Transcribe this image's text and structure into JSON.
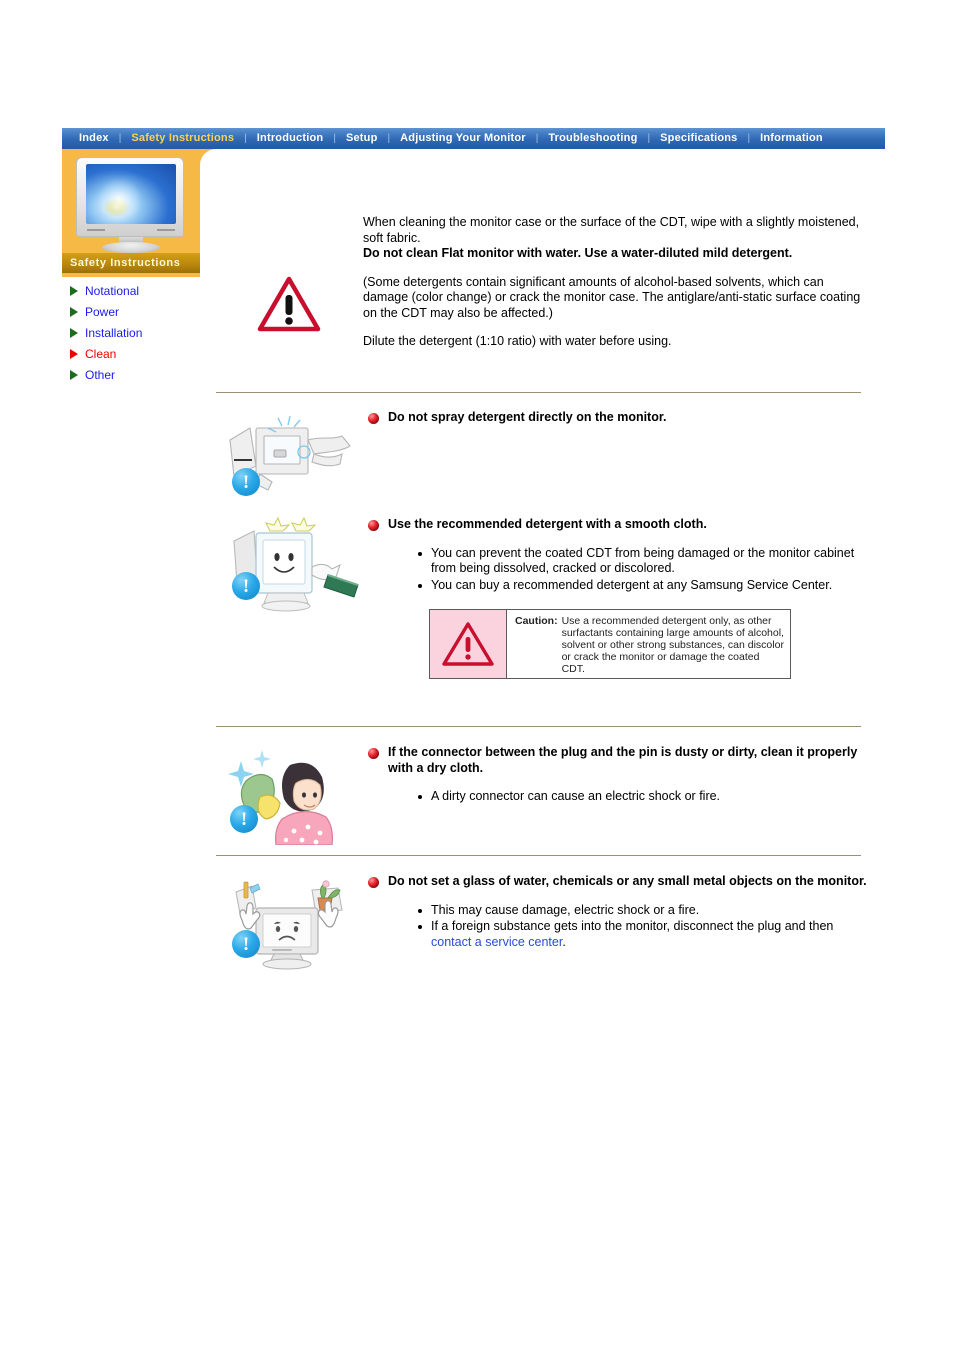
{
  "nav": {
    "items": [
      {
        "label": "Index",
        "active": false
      },
      {
        "label": "Safety Instructions",
        "active": true
      },
      {
        "label": "Introduction",
        "active": false
      },
      {
        "label": "Setup",
        "active": false
      },
      {
        "label": "Adjusting Your Monitor",
        "active": false
      },
      {
        "label": "Troubleshooting",
        "active": false
      },
      {
        "label": "Specifications",
        "active": false
      },
      {
        "label": "Information",
        "active": false
      }
    ],
    "separator": "|"
  },
  "sidebar": {
    "panel_label": "Safety Instructions",
    "thumbnail_icon": "monitor-thumbnail",
    "items": [
      {
        "label": "Notational",
        "active": false
      },
      {
        "label": "Power",
        "active": false
      },
      {
        "label": "Installation",
        "active": false
      },
      {
        "label": "Clean",
        "active": true
      },
      {
        "label": "Other",
        "active": false
      }
    ]
  },
  "intro": {
    "icon": "warning-triangle-icon",
    "para1": "When cleaning the monitor case or the surface of the CDT, wipe with a slightly moistened, soft fabric.",
    "para1_bold": "Do not clean Flat monitor with water. Use a water-diluted mild detergent.",
    "para2": "(Some detergents contain significant amounts of alcohol-based solvents, which can damage (color change) or crack the monitor case. The antiglare/anti-static surface coating on the CDT may also be affected.)",
    "para3": "Dilute the detergent (1:10 ratio) with water before using."
  },
  "sections": [
    {
      "icon": "spray-monitor-illustration",
      "badge_icon": "blue-exclamation-badge",
      "heading": "Do not spray detergent directly on the monitor.",
      "items": []
    },
    {
      "icon": "wipe-monitor-cloth-illustration",
      "badge_icon": "blue-exclamation-badge",
      "heading": "Use the recommended detergent with a smooth cloth.",
      "items": [
        "You can prevent the coated CDT from being damaged or the monitor cabinet from being dissolved, cracked or discolored.",
        "You can buy a recommended detergent at any Samsung Service Center."
      ],
      "caution": {
        "icon": "caution-triangle-icon",
        "label": "Caution:",
        "text": "Use a recommended detergent only, as other surfactants containing large amounts of alcohol, solvent or other strong substances, can discolor or crack the monitor or damage the coated CDT."
      }
    },
    {
      "icon": "woman-cleaning-plug-illustration",
      "badge_icon": "blue-exclamation-badge",
      "heading": "If the connector between the plug and the pin is dusty or dirty, clean it properly with a dry cloth.",
      "items": [
        "A dirty connector can cause an electric shock or fire."
      ]
    },
    {
      "icon": "objects-on-monitor-illustration",
      "badge_icon": "blue-exclamation-badge",
      "heading": "Do not set a glass of water, chemicals or any small metal objects on the monitor.",
      "items": [
        "This may cause damage, electric shock or a fire."
      ],
      "last_item_pre": "If a foreign substance gets into the monitor, disconnect the plug and then ",
      "last_item_link": "contact a service center",
      "last_item_post": "."
    }
  ],
  "colors": {
    "nav_blue": "#2f68b4",
    "nav_active": "#ffd24a",
    "panel_orange": "#f7b945",
    "panel_label_bg": "#b8860b",
    "link_blue": "#1a1af0",
    "active_red": "#ee0000",
    "divider": "#9d8e70",
    "caution_pink": "#fbd3de",
    "badge_blue": "#2aa8e8"
  }
}
